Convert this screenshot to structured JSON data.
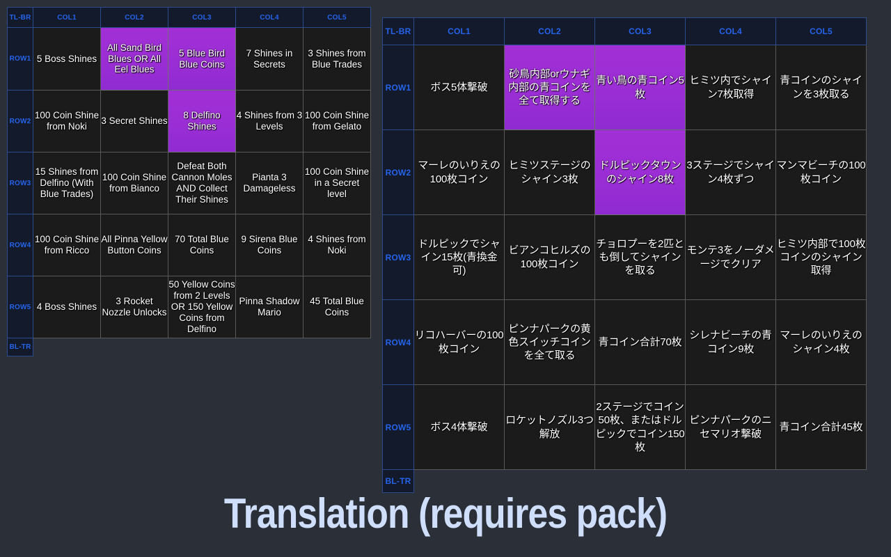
{
  "caption": "Translation (requires pack)",
  "colors": {
    "page_background": "#2b2f38",
    "header_background": "#131a2b",
    "header_text": "#2563eb",
    "header_border": "#2c4c8e",
    "cell_background": "#1b1b1b",
    "cell_border": "#595959",
    "cell_text": "#ffffff",
    "goal_highlight": "#9b2dd6",
    "caption_text": "#cfdffb"
  },
  "boards": {
    "english": {
      "corner_top_left": "TL-BR",
      "corner_bottom_left": "BL-TR",
      "columns": [
        "COL1",
        "COL2",
        "COL3",
        "COL4",
        "COL5"
      ],
      "rows": [
        "ROW1",
        "ROW2",
        "ROW3",
        "ROW4",
        "ROW5"
      ],
      "cells": [
        [
          {
            "text": "5 Boss Shines",
            "highlight": false
          },
          {
            "text": "All Sand Bird Blues OR All Eel Blues",
            "highlight": true
          },
          {
            "text": "5 Blue Bird Blue Coins",
            "highlight": true
          },
          {
            "text": "7 Shines in Secrets",
            "highlight": false
          },
          {
            "text": "3 Shines from Blue Trades",
            "highlight": false
          }
        ],
        [
          {
            "text": "100 Coin Shine from Noki",
            "highlight": false
          },
          {
            "text": "3 Secret Shines",
            "highlight": false
          },
          {
            "text": "8 Delfino Shines",
            "highlight": true
          },
          {
            "text": "4 Shines from 3 Levels",
            "highlight": false
          },
          {
            "text": "100 Coin Shine from Gelato",
            "highlight": false
          }
        ],
        [
          {
            "text": "15 Shines from Delfino (With Blue Trades)",
            "highlight": false
          },
          {
            "text": "100 Coin Shine from Bianco",
            "highlight": false
          },
          {
            "text": "Defeat Both Cannon Moles AND Collect Their Shines",
            "highlight": false
          },
          {
            "text": "Pianta 3 Damageless",
            "highlight": false
          },
          {
            "text": "100 Coin Shine in a Secret level",
            "highlight": false
          }
        ],
        [
          {
            "text": "100 Coin Shine from Ricco",
            "highlight": false
          },
          {
            "text": "All Pinna Yellow Button Coins",
            "highlight": false
          },
          {
            "text": "70 Total Blue Coins",
            "highlight": false
          },
          {
            "text": "9 Sirena Blue Coins",
            "highlight": false
          },
          {
            "text": "4 Shines from Noki",
            "highlight": false
          }
        ],
        [
          {
            "text": "4 Boss Shines",
            "highlight": false
          },
          {
            "text": "3 Rocket Nozzle Unlocks",
            "highlight": false
          },
          {
            "text": "50 Yellow Coins from 2 Levels OR 150 Yellow Coins from Delfino",
            "highlight": false
          },
          {
            "text": "Pinna Shadow Mario",
            "highlight": false
          },
          {
            "text": "45 Total Blue Coins",
            "highlight": false
          }
        ]
      ]
    },
    "japanese": {
      "corner_top_left": "TL-BR",
      "corner_bottom_left": "BL-TR",
      "columns": [
        "COL1",
        "COL2",
        "COL3",
        "COL4",
        "COL5"
      ],
      "rows": [
        "ROW1",
        "ROW2",
        "ROW3",
        "ROW4",
        "ROW5"
      ],
      "cells": [
        [
          {
            "text": "ボス5体撃破",
            "highlight": false
          },
          {
            "text": "砂鳥内部orウナギ内部の青コインを全て取得する",
            "highlight": true
          },
          {
            "text": "青い鳥の青コイン5枚",
            "highlight": true
          },
          {
            "text": "ヒミツ内でシャイン7枚取得",
            "highlight": false
          },
          {
            "text": "青コインのシャインを3枚取る",
            "highlight": false
          }
        ],
        [
          {
            "text": "マーレのいりえの100枚コイン",
            "highlight": false
          },
          {
            "text": "ヒミツステージのシャイン3枚",
            "highlight": false
          },
          {
            "text": "ドルピックタウンのシャイン8枚",
            "highlight": true
          },
          {
            "text": "3ステージでシャイン4枚ずつ",
            "highlight": false
          },
          {
            "text": "マンマビーチの100枚コイン",
            "highlight": false
          }
        ],
        [
          {
            "text": "ドルピックでシャイン15枚(青換金可)",
            "highlight": false
          },
          {
            "text": "ビアンコヒルズの100枚コイン",
            "highlight": false
          },
          {
            "text": "チョロプーを2匹とも倒してシャインを取る",
            "highlight": false
          },
          {
            "text": "モンテ3をノーダメージでクリア",
            "highlight": false
          },
          {
            "text": "ヒミツ内部で100枚コインのシャイン取得",
            "highlight": false
          }
        ],
        [
          {
            "text": "リコハーバーの100枚コイン",
            "highlight": false
          },
          {
            "text": "ピンナパークの黄色スイッチコインを全て取る",
            "highlight": false
          },
          {
            "text": "青コイン合計70枚",
            "highlight": false
          },
          {
            "text": "シレナビーチの青コイン9枚",
            "highlight": false
          },
          {
            "text": "マーレのいりえのシャイン4枚",
            "highlight": false
          }
        ],
        [
          {
            "text": "ボス4体撃破",
            "highlight": false
          },
          {
            "text": "ロケットノズル3つ解放",
            "highlight": false
          },
          {
            "text": "2ステージでコイン50枚、またはドルピックでコイン150枚",
            "highlight": false
          },
          {
            "text": "ピンナパークのニセマリオ撃破",
            "highlight": false
          },
          {
            "text": "青コイン合計45枚",
            "highlight": false
          }
        ]
      ]
    }
  }
}
